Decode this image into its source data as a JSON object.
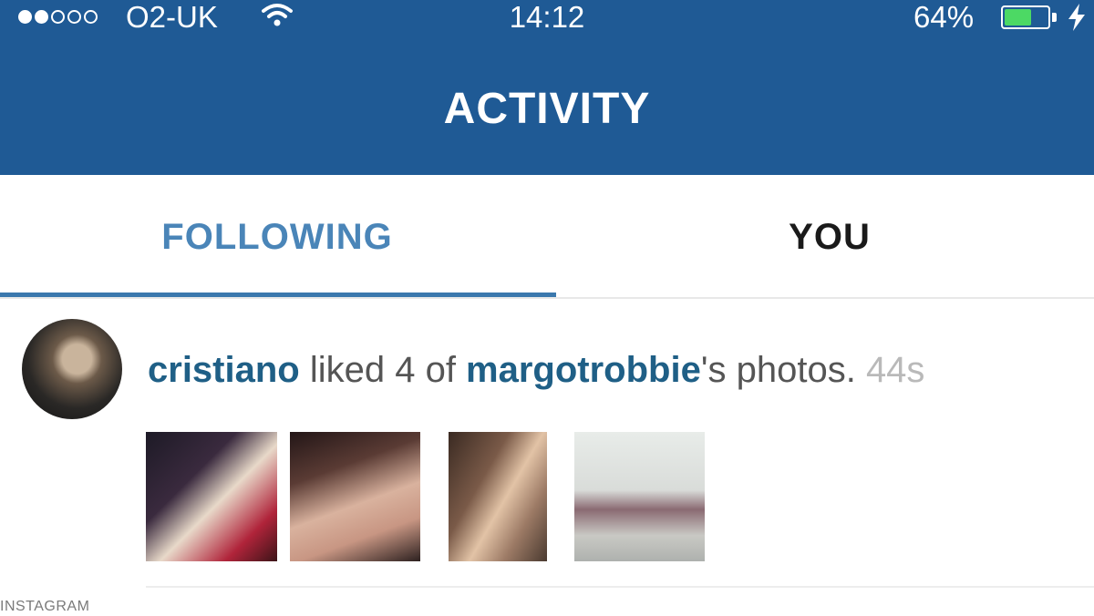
{
  "status_bar": {
    "carrier": "O2-UK",
    "time": "14:12",
    "battery_percent_text": "64%",
    "battery_level": 0.64,
    "signal_bars_filled": 2,
    "signal_bars_total": 5
  },
  "nav": {
    "title": "ACTIVITY"
  },
  "tabs": [
    {
      "label": "FOLLOWING",
      "active": true
    },
    {
      "label": "YOU",
      "active": false
    }
  ],
  "activity": {
    "actor": "cristiano",
    "action_text": " liked 4 of ",
    "target": "margotrobbie",
    "object_text": "'s photos.",
    "timestamp": "44s",
    "thumbnail_count": 4
  },
  "watermark": "INSTAGRAM",
  "colors": {
    "header_bg": "#1f5a95",
    "active_tab": "#4a85b8",
    "tab_indicator": "#3b78ad",
    "username": "#1f5f86",
    "timestamp": "#b9b9b9",
    "battery_fill": "#4cd964"
  },
  "icons": [
    "signal-dots-icon",
    "wifi-icon",
    "battery-icon",
    "charging-bolt-icon"
  ]
}
